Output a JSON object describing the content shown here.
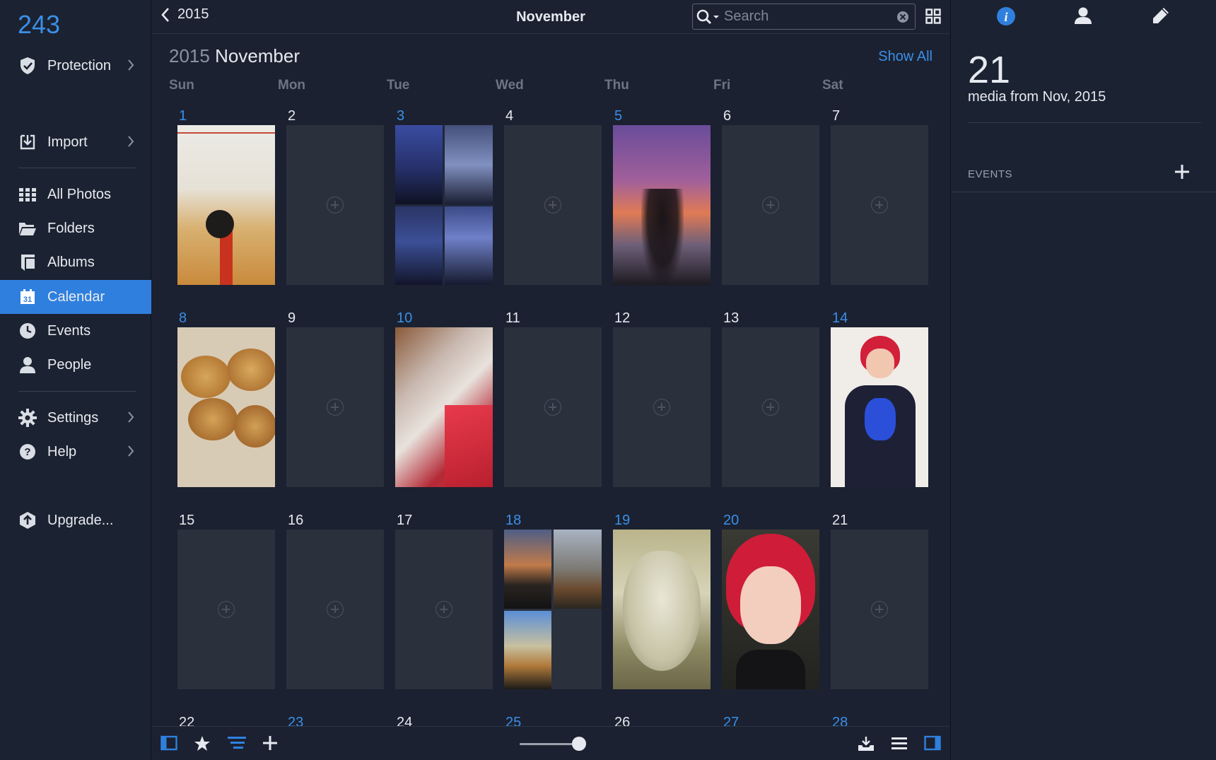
{
  "sidebar": {
    "count": "243",
    "items": [
      {
        "label": "Protection",
        "icon": "shield-icon"
      },
      {
        "label": "Import",
        "icon": "import-icon"
      },
      {
        "label": "All Photos",
        "icon": "grid-icon"
      },
      {
        "label": "Folders",
        "icon": "folder-icon"
      },
      {
        "label": "Albums",
        "icon": "album-icon"
      },
      {
        "label": "Calendar",
        "icon": "calendar-icon"
      },
      {
        "label": "Events",
        "icon": "clock-icon"
      },
      {
        "label": "People",
        "icon": "person-icon"
      },
      {
        "label": "Settings",
        "icon": "gear-icon"
      },
      {
        "label": "Help",
        "icon": "help-icon"
      },
      {
        "label": "Upgrade...",
        "icon": "upgrade-icon"
      }
    ],
    "calendar_icon_number": "31",
    "accent": "#2f80de"
  },
  "header": {
    "back_label": "2015",
    "title": "November",
    "search_placeholder": "Search"
  },
  "calendar": {
    "year": "2015",
    "month": "November",
    "show_all": "Show All",
    "weekdays": [
      "Sun",
      "Mon",
      "Tue",
      "Wed",
      "Thu",
      "Fri",
      "Sat"
    ],
    "weeks": [
      [
        "1",
        "2",
        "3",
        "4",
        "5",
        "6",
        "7"
      ],
      [
        "8",
        "9",
        "10",
        "11",
        "12",
        "13",
        "14"
      ],
      [
        "15",
        "16",
        "17",
        "18",
        "19",
        "20",
        "21"
      ],
      [
        "22",
        "23",
        "24",
        "25",
        "26",
        "27",
        "28"
      ]
    ]
  },
  "info": {
    "media_count": "21",
    "media_from": "media from Nov, 2015",
    "events_label": "EVENTS"
  }
}
